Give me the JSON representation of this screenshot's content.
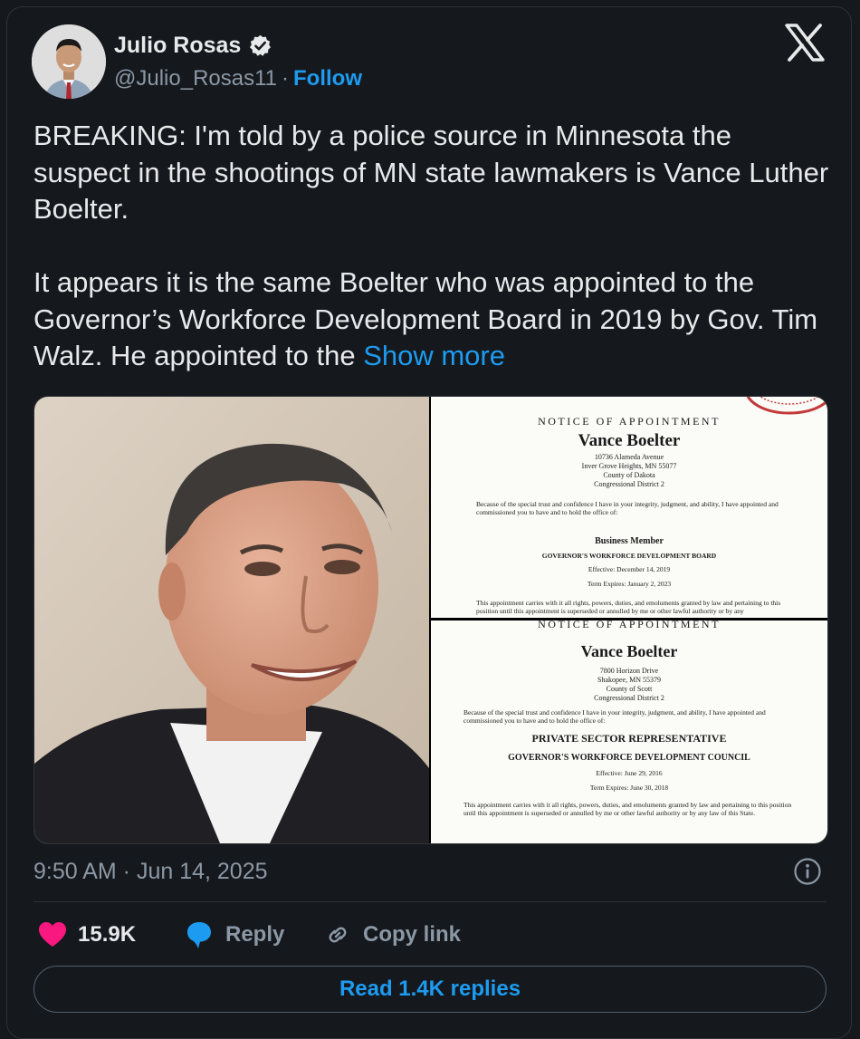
{
  "author": {
    "name": "Julio Rosas",
    "handle": "@Julio_Rosas11",
    "separator": "·",
    "follow_label": "Follow"
  },
  "tweet": {
    "paragraph1": "BREAKING: I'm told by a police source in Minnesota the suspect in the shootings of MN state lawmakers is Vance Luther Boelter.",
    "paragraph2": "It appears it is the same Boelter who was appointed to the Governor’s Workforce Development Board in 2019 by Gov. Tim Walz. He appointed to the",
    "show_more_label": "Show more"
  },
  "media": {
    "doc1": {
      "header": "NOTICE OF APPOINTMENT",
      "name": "Vance Boelter",
      "address": [
        "10736 Alameda Avenue",
        "Inver Grove Heights, MN 55077",
        "County of Dakota",
        "Congressional District 2"
      ],
      "body": "Because of the special trust and confidence I have in your integrity, judgment, and ability, I have appointed and commissioned you to have and to hold the office of:",
      "role": "Business Member",
      "board": "GOVERNOR'S WORKFORCE DEVELOPMENT BOARD",
      "effective": "Effective: December 14, 2019",
      "expires": "Term Expires: January 2, 2023",
      "footer": "This appointment carries with it all rights, powers, duties, and emoluments granted by law and pertaining to this position until this appointment is superseded or annulled by me or other lawful authority or by any"
    },
    "doc2": {
      "header": "NOTICE OF APPOINTMENT",
      "name": "Vance Boelter",
      "address": [
        "7800 Horizon Drive",
        "Shakopee, MN 55379",
        "County of Scott",
        "Congressional District 2"
      ],
      "body": "Because of the special trust and confidence I have in your integrity, judgment, and ability, I have appointed and commissioned you to have and to hold the office of:",
      "role": "PRIVATE SECTOR REPRESENTATIVE",
      "board": "GOVERNOR'S WORKFORCE DEVELOPMENT COUNCIL",
      "effective": "Effective: June 29, 2016",
      "expires": "Term Expires: June 30, 2018",
      "footer": "This appointment carries with it all rights, powers, duties, and emoluments granted by law and pertaining to this position until this appointment is superseded or annulled by me or other lawful authority or by any law of this State."
    }
  },
  "timestamp": "9:50 AM · Jun 14, 2025",
  "actions": {
    "likes_count": "15.9K",
    "reply_label": "Reply",
    "copy_link_label": "Copy link"
  },
  "read_replies_label": "Read 1.4K replies",
  "colors": {
    "background": "#15181d",
    "accent": "#1d9bf0",
    "like": "#f91880",
    "muted": "#8b98a5"
  },
  "icons": [
    "verified-badge-icon",
    "x-logo-icon",
    "info-icon",
    "heart-icon",
    "reply-bubble-icon",
    "link-icon"
  ]
}
